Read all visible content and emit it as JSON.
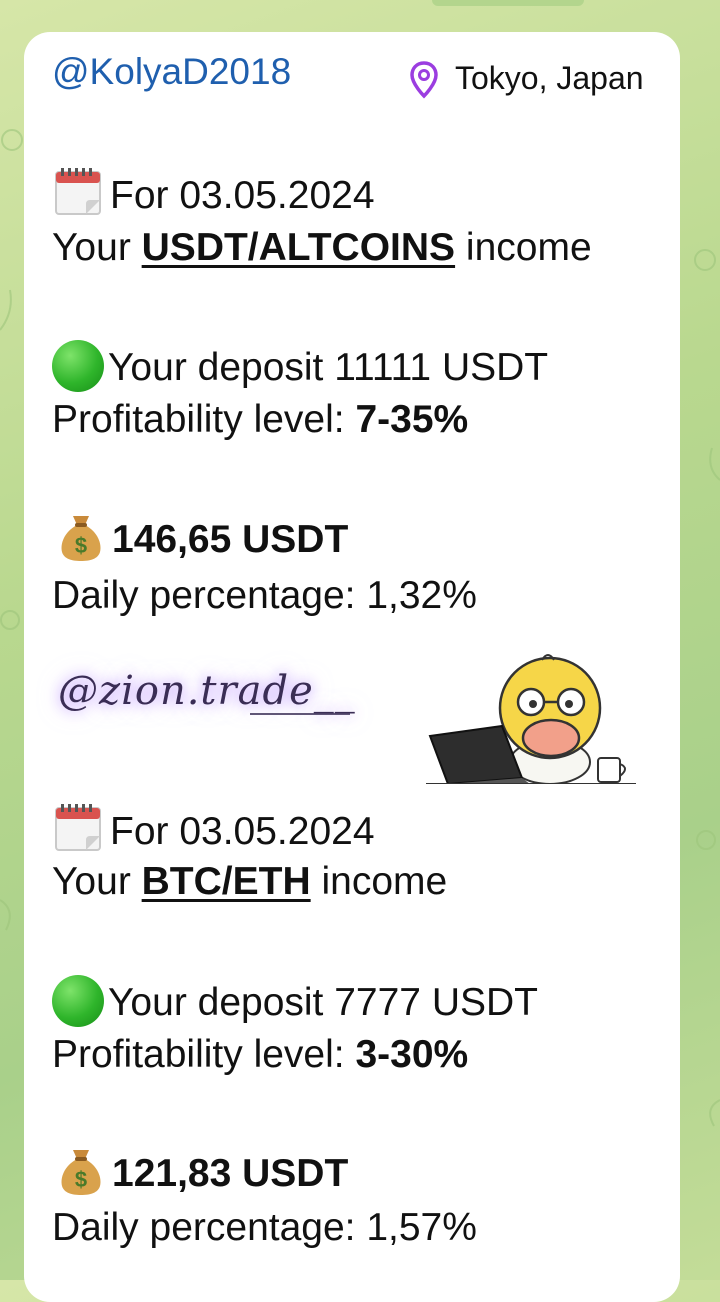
{
  "message": {
    "sender": "@KolyaD2018",
    "location": "Tokyo, Japan",
    "report1": {
      "date_line": "For 03.05.2024",
      "income_prefix": "Your ",
      "pair": "USDT/ALTCOINS",
      "income_suffix": " income",
      "deposit": "Your deposit 11111 USDT",
      "profitability_label": " Profitability level: ",
      "profitability_value": "7-35%",
      "amount": "146,65 USDT",
      "daily": "Daily percentage: 1,32%"
    },
    "signature": "@zion.trade__",
    "report2": {
      "date_line": "For 03.05.2024",
      "income_prefix": "Your ",
      "pair": "BTC/ETH",
      "income_suffix": " income",
      "deposit": "Your deposit 7777 USDT",
      "profitability_label": " Profitability level: ",
      "profitability_value": "3-30%",
      "amount": "121,83 USDT",
      "daily": "Daily percentage: 1,57%"
    }
  },
  "icons": {
    "calendar": "calendar-icon",
    "green_circle": "green-circle-icon",
    "money_bag": "money-bag-icon",
    "location": "location-pin-icon",
    "sticker": "duck-laptop-sticker"
  },
  "colors": {
    "sender": "#1f5fae",
    "location_pin": "#9b3de0",
    "bubble": "#ffffff",
    "background": "#b9d88f"
  }
}
